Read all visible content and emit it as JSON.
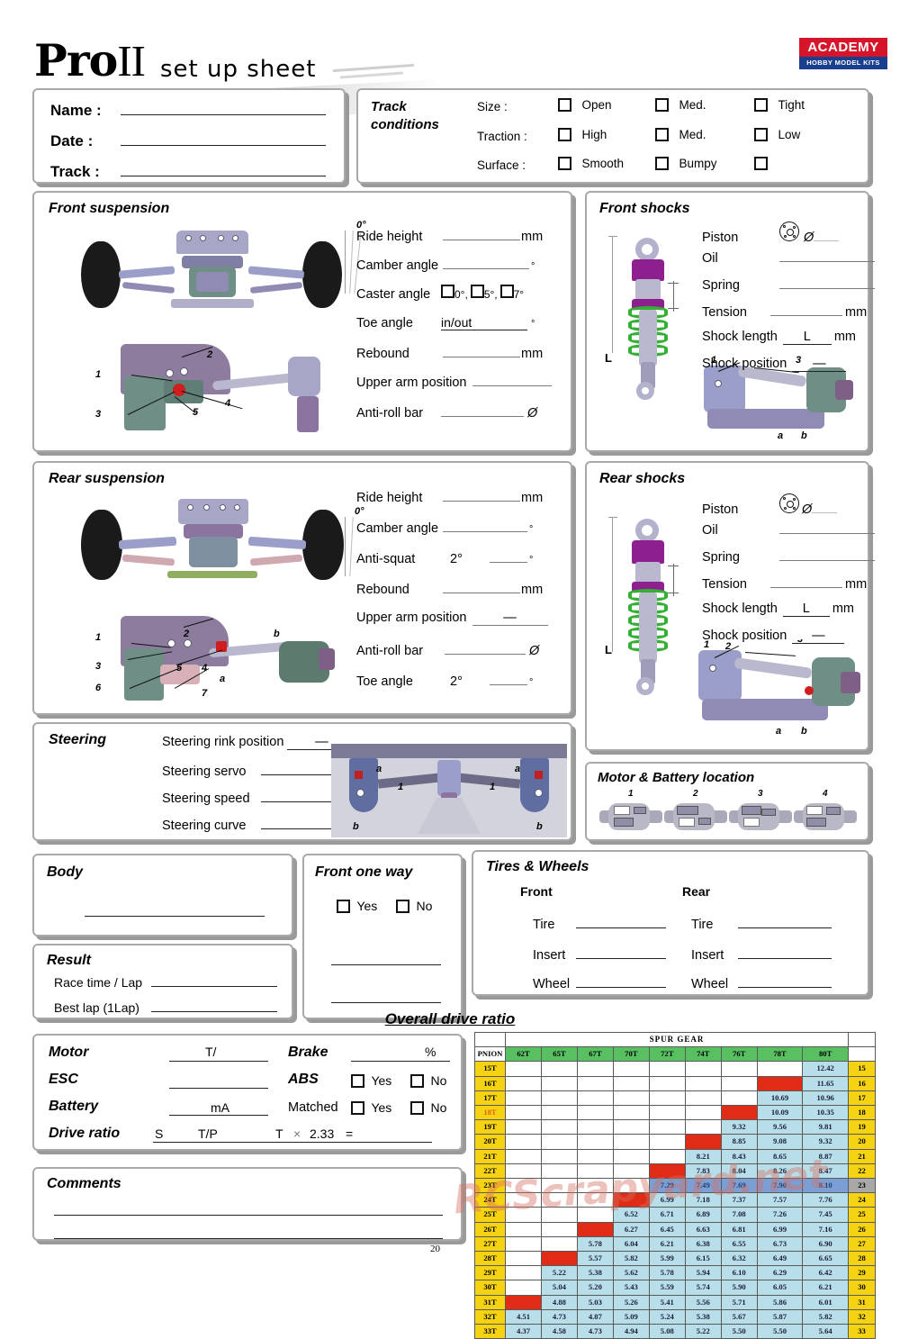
{
  "brand": {
    "title_main": "Pro",
    "title_numeral": "II",
    "subtitle": "set up sheet",
    "logo_top": "ACADEMY",
    "logo_bottom": "HOBBY MODEL KITS",
    "logo_red": "#d7152a",
    "logo_blue": "#1b3f8f"
  },
  "identity": {
    "name_label": "Name :",
    "date_label": "Date :",
    "track_label": "Track :"
  },
  "track_conditions": {
    "title_line1": "Track",
    "title_line2": "conditions",
    "rows": [
      {
        "label": "Size :",
        "options": [
          "Open",
          "Med.",
          "Tight"
        ]
      },
      {
        "label": "Traction :",
        "options": [
          "High",
          "Med.",
          "Low"
        ]
      },
      {
        "label": "Surface :",
        "options": [
          "Smooth",
          "Bumpy",
          ""
        ]
      }
    ]
  },
  "front_suspension": {
    "title": "Front suspension",
    "angle_mark": "0°",
    "callouts": [
      "1",
      "2",
      "3",
      "4",
      "5"
    ],
    "fields": [
      {
        "label": "Ride height",
        "unit": "mm"
      },
      {
        "label": "Camber angle",
        "unit": "°"
      },
      {
        "label": "Caster angle",
        "unit": "",
        "checkbox_options": [
          "0°,",
          "5°,",
          "7°"
        ]
      },
      {
        "label": "Toe angle",
        "unit": "°",
        "prefix": "in/out"
      },
      {
        "label": "Rebound",
        "unit": "mm"
      },
      {
        "label": "Upper arm position",
        "unit": ""
      },
      {
        "label": "Anti-roll bar",
        "unit": "Ø"
      }
    ]
  },
  "front_shocks": {
    "title": "Front shocks",
    "length_mark": "L",
    "callouts": [
      "1",
      "3",
      "a",
      "b"
    ],
    "fields": [
      {
        "label": "Piston",
        "unit": "Ø",
        "icon": "piston-icon"
      },
      {
        "label": "Oil",
        "unit": ""
      },
      {
        "label": "Spring",
        "unit": ""
      },
      {
        "label": "Tension",
        "unit": "mm"
      },
      {
        "label": "Shock length",
        "unit": "mm",
        "prefix": "L"
      },
      {
        "label": "Shock position",
        "unit": "",
        "prefix": "—"
      }
    ]
  },
  "rear_suspension": {
    "title": "Rear suspension",
    "angle_mark": "0°",
    "callouts": [
      "1",
      "2",
      "3",
      "4",
      "5",
      "6",
      "7",
      "a",
      "b"
    ],
    "fields": [
      {
        "label": "Ride height",
        "unit": "mm"
      },
      {
        "label": "Camber angle",
        "unit": "°"
      },
      {
        "label": "Anti-squat",
        "unit": "°",
        "prefix": "2°"
      },
      {
        "label": "Rebound",
        "unit": "mm"
      },
      {
        "label": "Upper arm position",
        "unit": "",
        "midmark": "—"
      },
      {
        "label": "Anti-roll bar",
        "unit": "Ø"
      },
      {
        "label": "Toe angle",
        "unit": "°",
        "prefix": "2°"
      }
    ]
  },
  "rear_shocks": {
    "title": "Rear shocks",
    "length_mark": "L",
    "callouts": [
      "1",
      "2",
      "3",
      "a",
      "b"
    ],
    "fields": [
      {
        "label": "Piston",
        "unit": "Ø",
        "icon": "piston-icon"
      },
      {
        "label": "Oil",
        "unit": ""
      },
      {
        "label": "Spring",
        "unit": ""
      },
      {
        "label": "Tension",
        "unit": "mm"
      },
      {
        "label": "Shock length",
        "unit": "mm",
        "prefix": "L"
      },
      {
        "label": "Shock position",
        "unit": "",
        "prefix": "—"
      }
    ]
  },
  "steering": {
    "title": "Steering",
    "callouts": [
      "a",
      "b",
      "1",
      "a",
      "b",
      "1"
    ],
    "fields": [
      {
        "label": "Steering rink position",
        "unit": "",
        "midmark": "—"
      },
      {
        "label": "Steering servo",
        "unit": ""
      },
      {
        "label": "Steering speed",
        "unit": "%"
      },
      {
        "label": "Steering curve",
        "unit": "%"
      }
    ]
  },
  "motor_battery": {
    "title": "Motor & Battery location",
    "positions": [
      "1",
      "2",
      "3",
      "4"
    ]
  },
  "body": {
    "title": "Body"
  },
  "result": {
    "title": "Result",
    "fields": [
      {
        "label": "Race time / Lap"
      },
      {
        "label": "Best lap (1Lap)"
      }
    ]
  },
  "front_one_way": {
    "title": "Front one way",
    "options": [
      "Yes",
      "No"
    ],
    "extra_lines": 2
  },
  "tires_wheels": {
    "title": "Tires & Wheels",
    "columns": [
      "Front",
      "Rear"
    ],
    "rows": [
      "Tire",
      "Insert",
      "Wheel"
    ]
  },
  "electronics": {
    "left": [
      {
        "label": "Motor",
        "unit": "T/"
      },
      {
        "label": "ESC",
        "unit": ""
      },
      {
        "label": "Battery",
        "unit": "mA"
      },
      {
        "label": "Drive ratio"
      }
    ],
    "drive_ratio_parts": {
      "s": "S",
      "tp": "T/P",
      "t": "T",
      "times": "×",
      "factor": "2.33",
      "eq": "="
    },
    "right": [
      {
        "label": "Brake",
        "unit": "%"
      },
      {
        "label": "ABS",
        "options": [
          "Yes",
          "No"
        ]
      },
      {
        "label": "Matched",
        "options": [
          "Yes",
          "No"
        ]
      }
    ]
  },
  "comments": {
    "title": "Comments",
    "lines": 2
  },
  "page_number": "20",
  "watermark": "RCScrapyard.net",
  "chart_data": {
    "type": "table",
    "title": "Overall drive ratio",
    "spur_header": "SPUR GEAR",
    "pinion_header": "PNION",
    "columns": [
      "62T",
      "65T",
      "67T",
      "70T",
      "72T",
      "74T",
      "76T",
      "78T",
      "80T"
    ],
    "rows": [
      {
        "pinion": "15T",
        "right": "15",
        "values": [
          "",
          "",
          "",
          "",
          "",
          "",
          "",
          "",
          "12.42"
        ],
        "states": [
          "blank",
          "blank",
          "blank",
          "blank",
          "blank",
          "blank",
          "blank",
          "blank",
          "val"
        ]
      },
      {
        "pinion": "16T",
        "right": "16",
        "values": [
          "",
          "",
          "",
          "",
          "",
          "",
          "",
          "",
          "11.65"
        ],
        "states": [
          "blank",
          "blank",
          "blank",
          "blank",
          "blank",
          "blank",
          "blank",
          "red",
          "val"
        ]
      },
      {
        "pinion": "17T",
        "right": "17",
        "values": [
          "",
          "",
          "",
          "",
          "",
          "",
          "",
          "10.69",
          "10.96"
        ],
        "states": [
          "blank",
          "blank",
          "blank",
          "blank",
          "blank",
          "blank",
          "blank",
          "val",
          "val"
        ]
      },
      {
        "pinion": "18T",
        "right": "18",
        "values": [
          "",
          "",
          "",
          "",
          "",
          "",
          "",
          "10.09",
          "10.35"
        ],
        "states": [
          "blank",
          "blank",
          "blank",
          "blank",
          "blank",
          "blank",
          "red",
          "val",
          "val"
        ],
        "pinion_highlight": true
      },
      {
        "pinion": "19T",
        "right": "19",
        "values": [
          "",
          "",
          "",
          "",
          "",
          "",
          "9.32",
          "9.56",
          "9.81"
        ],
        "states": [
          "blank",
          "blank",
          "blank",
          "blank",
          "blank",
          "blank",
          "val",
          "val",
          "val"
        ]
      },
      {
        "pinion": "20T",
        "right": "20",
        "values": [
          "",
          "",
          "",
          "",
          "",
          "",
          "8.85",
          "9.08",
          "9.32"
        ],
        "states": [
          "blank",
          "blank",
          "blank",
          "blank",
          "blank",
          "red",
          "val",
          "val",
          "val"
        ]
      },
      {
        "pinion": "21T",
        "right": "21",
        "values": [
          "",
          "",
          "",
          "",
          "",
          "8.21",
          "8.43",
          "8.65",
          "8.87"
        ],
        "states": [
          "blank",
          "blank",
          "blank",
          "blank",
          "blank",
          "val",
          "val",
          "val",
          "val"
        ]
      },
      {
        "pinion": "22T",
        "right": "22",
        "values": [
          "",
          "",
          "",
          "",
          "",
          "7.83",
          "8.04",
          "8.26",
          "8.47"
        ],
        "states": [
          "blank",
          "blank",
          "blank",
          "blank",
          "red",
          "val",
          "val",
          "val",
          "val"
        ]
      },
      {
        "pinion": "23T",
        "right": "23",
        "values": [
          "",
          "",
          "",
          "",
          "7.29",
          "7.49",
          "7.69",
          "7.90",
          "8.10"
        ],
        "states": [
          "blank",
          "blank",
          "blank",
          "blank",
          "hl",
          "hl",
          "hl",
          "hl",
          "hl"
        ],
        "row_highlight": true
      },
      {
        "pinion": "24T",
        "right": "24",
        "values": [
          "",
          "",
          "",
          "",
          "6.99",
          "7.18",
          "7.37",
          "7.57",
          "7.76"
        ],
        "states": [
          "blank",
          "blank",
          "blank",
          "red",
          "val",
          "val",
          "val",
          "val",
          "val"
        ]
      },
      {
        "pinion": "25T",
        "right": "25",
        "values": [
          "",
          "",
          "",
          "6.52",
          "6.71",
          "6.89",
          "7.08",
          "7.26",
          "7.45"
        ],
        "states": [
          "blank",
          "blank",
          "blank",
          "val",
          "val",
          "val",
          "val",
          "val",
          "val"
        ]
      },
      {
        "pinion": "26T",
        "right": "26",
        "values": [
          "",
          "",
          "",
          "6.27",
          "6.45",
          "6.63",
          "6.81",
          "6.99",
          "7.16"
        ],
        "states": [
          "blank",
          "blank",
          "red",
          "val",
          "val",
          "val",
          "val",
          "val",
          "val"
        ]
      },
      {
        "pinion": "27T",
        "right": "27",
        "values": [
          "",
          "",
          "5.78",
          "6.04",
          "6.21",
          "6.38",
          "6.55",
          "6.73",
          "6.90"
        ],
        "states": [
          "blank",
          "blank",
          "val",
          "val",
          "val",
          "val",
          "val",
          "val",
          "val"
        ]
      },
      {
        "pinion": "28T",
        "right": "28",
        "values": [
          "",
          "",
          "5.57",
          "5.82",
          "5.99",
          "6.15",
          "6.32",
          "6.49",
          "6.65"
        ],
        "states": [
          "blank",
          "red",
          "val",
          "val",
          "val",
          "val",
          "val",
          "val",
          "val"
        ]
      },
      {
        "pinion": "29T",
        "right": "29",
        "values": [
          "",
          "5.22",
          "5.38",
          "5.62",
          "5.78",
          "5.94",
          "6.10",
          "6.29",
          "6.42"
        ],
        "states": [
          "blank",
          "val",
          "val",
          "val",
          "val",
          "val",
          "val",
          "val",
          "val"
        ]
      },
      {
        "pinion": "30T",
        "right": "30",
        "values": [
          "",
          "5.04",
          "5.20",
          "5.43",
          "5.59",
          "5.74",
          "5.90",
          "6.05",
          "6.21"
        ],
        "states": [
          "blank",
          "val",
          "val",
          "val",
          "val",
          "val",
          "val",
          "val",
          "val"
        ]
      },
      {
        "pinion": "31T",
        "right": "31",
        "values": [
          "",
          "4.88",
          "5.03",
          "5.26",
          "5.41",
          "5.56",
          "5.71",
          "5.86",
          "6.01"
        ],
        "states": [
          "red",
          "val",
          "val",
          "val",
          "val",
          "val",
          "val",
          "val",
          "val"
        ]
      },
      {
        "pinion": "32T",
        "right": "32",
        "values": [
          "4.51",
          "4.73",
          "4.87",
          "5.09",
          "5.24",
          "5.38",
          "5.67",
          "5.87",
          "5.82"
        ],
        "states": [
          "val",
          "val",
          "val",
          "val",
          "val",
          "val",
          "val",
          "val",
          "val"
        ]
      },
      {
        "pinion": "33T",
        "right": "33",
        "values": [
          "4.37",
          "4.58",
          "4.73",
          "4.94",
          "5.08",
          "5.22",
          "5.50",
          "5.50",
          "5.64"
        ],
        "states": [
          "val",
          "val",
          "val",
          "val",
          "val",
          "val",
          "val",
          "val",
          "val"
        ]
      }
    ],
    "colors": {
      "header_green": "#58c060",
      "pinion_yellow": "#f5d312",
      "value_blue": "#b8dfe9",
      "highlight_blue": "#7b9fd4",
      "marker_red": "#e02b16"
    }
  }
}
